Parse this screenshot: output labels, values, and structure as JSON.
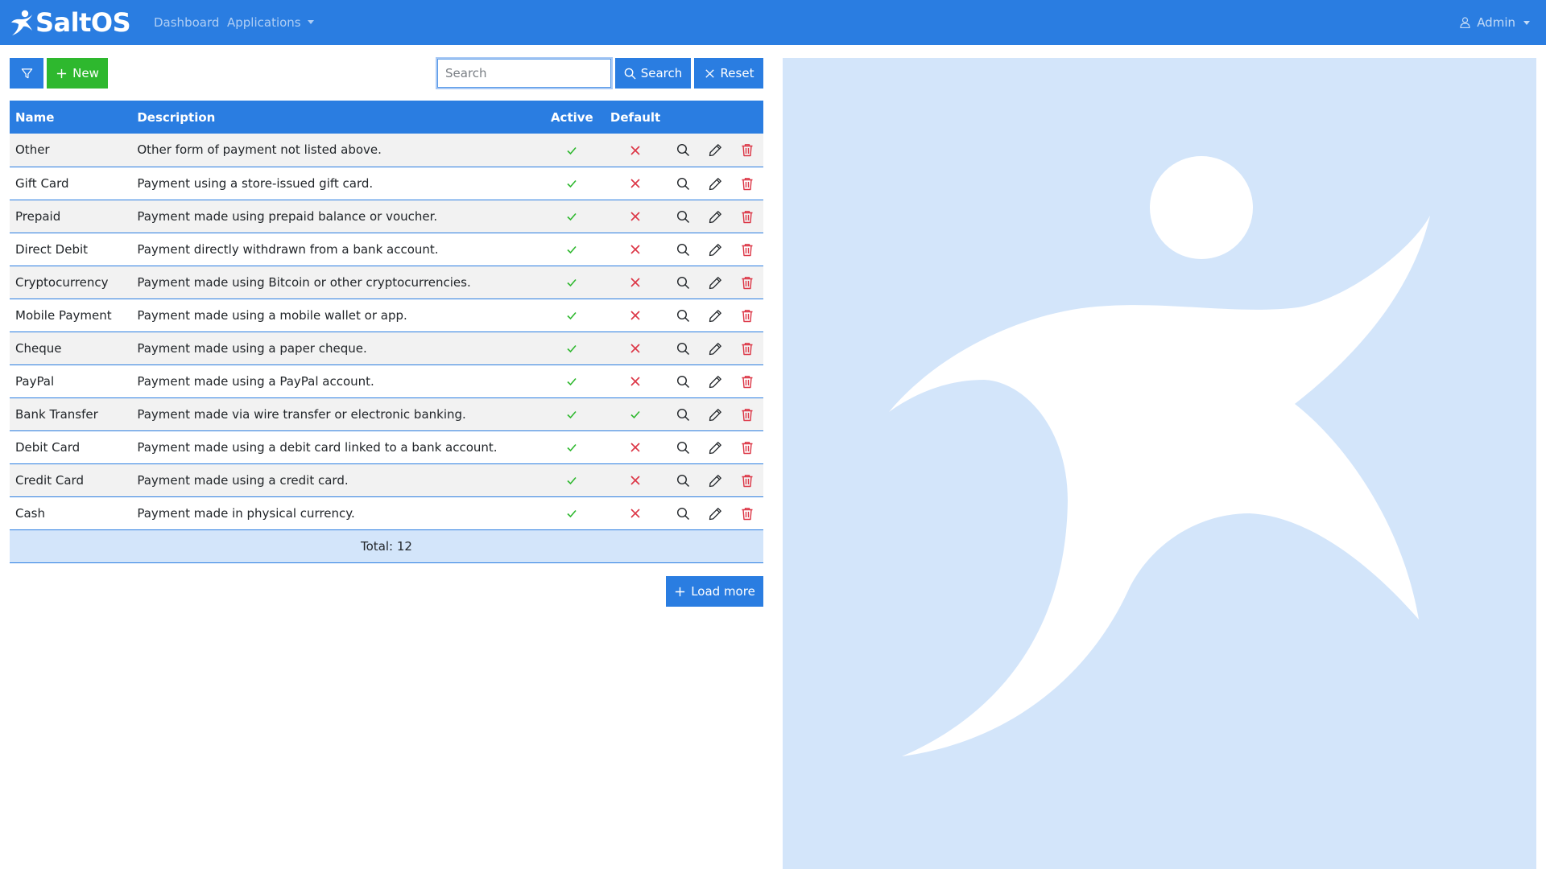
{
  "brand": {
    "name": "SaltOS"
  },
  "nav": {
    "dashboard": "Dashboard",
    "applications": "Applications",
    "user": "Admin"
  },
  "toolbar": {
    "new_label": "New",
    "search_placeholder": "Search",
    "search_value": "",
    "search_label": "Search",
    "reset_label": "Reset"
  },
  "table": {
    "headers": {
      "name": "Name",
      "description": "Description",
      "active": "Active",
      "default": "Default"
    },
    "rows": [
      {
        "name": "Other",
        "description": "Other form of payment not listed above.",
        "active": true,
        "default": false
      },
      {
        "name": "Gift Card",
        "description": "Payment using a store-issued gift card.",
        "active": true,
        "default": false
      },
      {
        "name": "Prepaid",
        "description": "Payment made using prepaid balance or voucher.",
        "active": true,
        "default": false
      },
      {
        "name": "Direct Debit",
        "description": "Payment directly withdrawn from a bank account.",
        "active": true,
        "default": false
      },
      {
        "name": "Cryptocurrency",
        "description": "Payment made using Bitcoin or other cryptocurrencies.",
        "active": true,
        "default": false
      },
      {
        "name": "Mobile Payment",
        "description": "Payment made using a mobile wallet or app.",
        "active": true,
        "default": false
      },
      {
        "name": "Cheque",
        "description": "Payment made using a paper cheque.",
        "active": true,
        "default": false
      },
      {
        "name": "PayPal",
        "description": "Payment made using a PayPal account.",
        "active": true,
        "default": false
      },
      {
        "name": "Bank Transfer",
        "description": "Payment made via wire transfer or electronic banking.",
        "active": true,
        "default": true
      },
      {
        "name": "Debit Card",
        "description": "Payment made using a debit card linked to a bank account.",
        "active": true,
        "default": false
      },
      {
        "name": "Credit Card",
        "description": "Payment made using a credit card.",
        "active": true,
        "default": false
      },
      {
        "name": "Cash",
        "description": "Payment made in physical currency.",
        "active": true,
        "default": false
      }
    ],
    "total_label": "Total: 12"
  },
  "load_more_label": "Load more",
  "icons": {
    "brand": "saltos-figure-icon",
    "user": "user-icon",
    "filter": "filter-icon",
    "new": "plus-icon",
    "search": "search-icon",
    "reset": "x-icon",
    "active_true": "check-icon",
    "active_false": "x-icon",
    "view": "magnifier-icon",
    "edit": "pencil-icon",
    "delete": "trash-icon",
    "load_more": "plus-icon"
  },
  "colors": {
    "primary": "#2a7de1",
    "success": "#2eb82e",
    "check": "#2eb82e",
    "cross": "#dc3545",
    "danger": "#dc3545",
    "panel": "#d3e5fa",
    "row_stripe": "#f2f2f2"
  }
}
